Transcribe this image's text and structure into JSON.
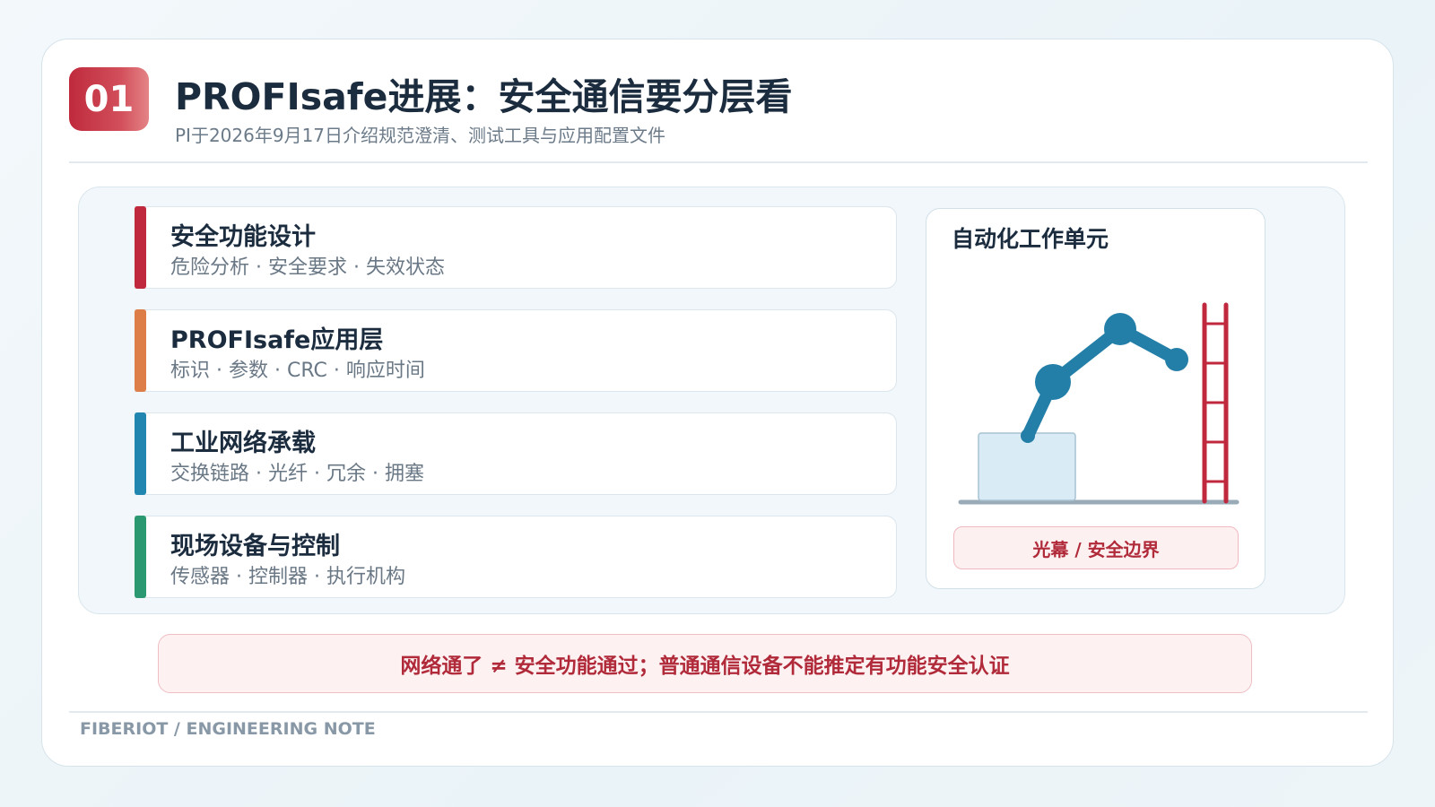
{
  "header": {
    "badge_number": "01",
    "title": "PROFIsafe进展：安全通信要分层看",
    "subtitle": "PI于2026年9月17日介绍规范澄清、测试工具与应用配置文件"
  },
  "layers": [
    {
      "title": "安全功能设计",
      "description": "危险分析 · 安全要求 · 失效状态",
      "color": "#c0283e"
    },
    {
      "title": "PROFIsafe应用层",
      "description": "标识 · 参数 · CRC · 响应时间",
      "color": "#dd7d47"
    },
    {
      "title": "工业网络承载",
      "description": "交换链路 · 光纤 · 冗余 · 拥塞",
      "color": "#2287b0"
    },
    {
      "title": "现场设备与控制",
      "description": "传感器 · 控制器 · 执行机构",
      "color": "#2a9871"
    }
  ],
  "work_cell": {
    "title": "自动化工作单元",
    "light_curtain_label": "光幕 / 安全边界",
    "illustration_icons": [
      "robot-arm-icon",
      "workpiece-box-icon",
      "light-curtain-icon"
    ],
    "colors": {
      "robot": "#237fa8",
      "curtain": "#c0283e",
      "box_fill": "#d9ebf4",
      "floor": "#9aabb8"
    }
  },
  "warning": {
    "text": "网络通了 ≠ 安全功能通过；普通通信设备不能推定有功能安全认证"
  },
  "footer": {
    "text": "FIBERIOT / ENGINEERING NOTE"
  },
  "theme": {
    "accent_red": "#c0283e",
    "text_dark": "#1c2c3f",
    "text_muted": "#6a7886"
  }
}
